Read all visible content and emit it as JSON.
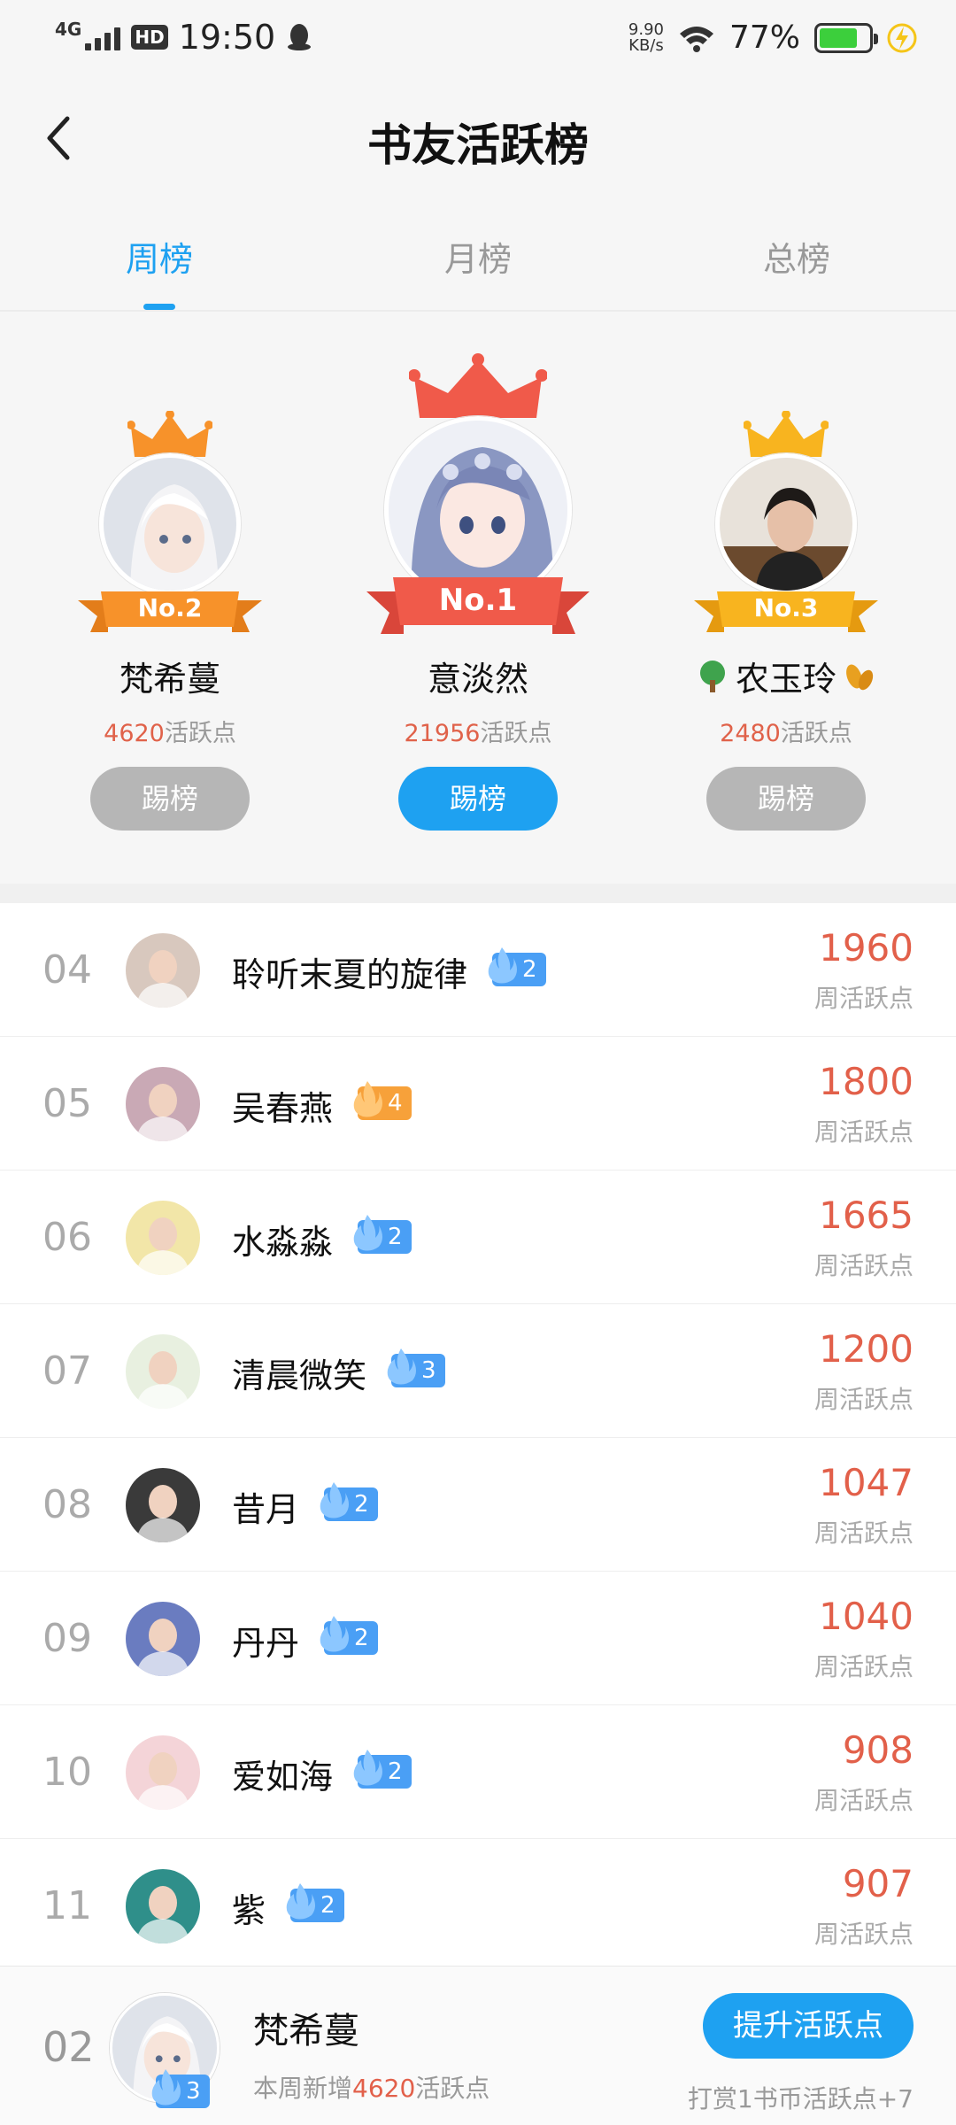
{
  "status_bar": {
    "network": "4G",
    "hd": "HD",
    "time": "19:50",
    "speed_value": "9.90",
    "speed_unit": "KB/s",
    "battery_percent": "77%",
    "battery_level": 0.77
  },
  "header": {
    "title": "书友活跃榜"
  },
  "tabs": [
    "周榜",
    "月榜",
    "总榜"
  ],
  "podium": {
    "first": {
      "name": "意淡然",
      "rank_label": "No.1",
      "points": "21956",
      "points_unit": "活跃点",
      "kick_label": "踢榜"
    },
    "second": {
      "name": "梵希蔓",
      "rank_label": "No.2",
      "points": "4620",
      "points_unit": "活跃点",
      "kick_label": "踢榜"
    },
    "third": {
      "name": "农玉玲",
      "rank_label": "No.3",
      "points": "2480",
      "points_unit": "活跃点",
      "kick_label": "踢榜"
    }
  },
  "list": [
    {
      "rank": "04",
      "name": "聆听末夏的旋律",
      "level": "2",
      "badge_color": "#4a9ff5",
      "score": "1960",
      "score_label": "周活跃点"
    },
    {
      "rank": "05",
      "name": "吴春燕",
      "level": "4",
      "badge_color": "#f7a13a",
      "score": "1800",
      "score_label": "周活跃点"
    },
    {
      "rank": "06",
      "name": "水淼淼",
      "level": "2",
      "badge_color": "#4a9ff5",
      "score": "1665",
      "score_label": "周活跃点"
    },
    {
      "rank": "07",
      "name": "清晨微笑",
      "level": "3",
      "badge_color": "#4a9ff5",
      "score": "1200",
      "score_label": "周活跃点"
    },
    {
      "rank": "08",
      "name": "昔月",
      "level": "2",
      "badge_color": "#4a9ff5",
      "score": "1047",
      "score_label": "周活跃点"
    },
    {
      "rank": "09",
      "name": "丹丹",
      "level": "2",
      "badge_color": "#4a9ff5",
      "score": "1040",
      "score_label": "周活跃点"
    },
    {
      "rank": "10",
      "name": "爱如海",
      "level": "2",
      "badge_color": "#4a9ff5",
      "score": "908",
      "score_label": "周活跃点"
    },
    {
      "rank": "11",
      "name": "紫",
      "level": "2",
      "badge_color": "#4a9ff5",
      "score": "907",
      "score_label": "周活跃点"
    }
  ],
  "me": {
    "rank": "02",
    "name": "梵希蔓",
    "level": "3",
    "sub_prefix": "本周新增",
    "sub_points": "4620",
    "sub_suffix": "活跃点",
    "boost_label": "提升活跃点",
    "boost_hint": "打赏1书币活跃点+7"
  },
  "colors": {
    "accent": "#1ea1f1",
    "score": "#e2604a",
    "first_place": "#f05a4a",
    "second_place": "#f7922a",
    "third_place": "#f8b41f"
  }
}
